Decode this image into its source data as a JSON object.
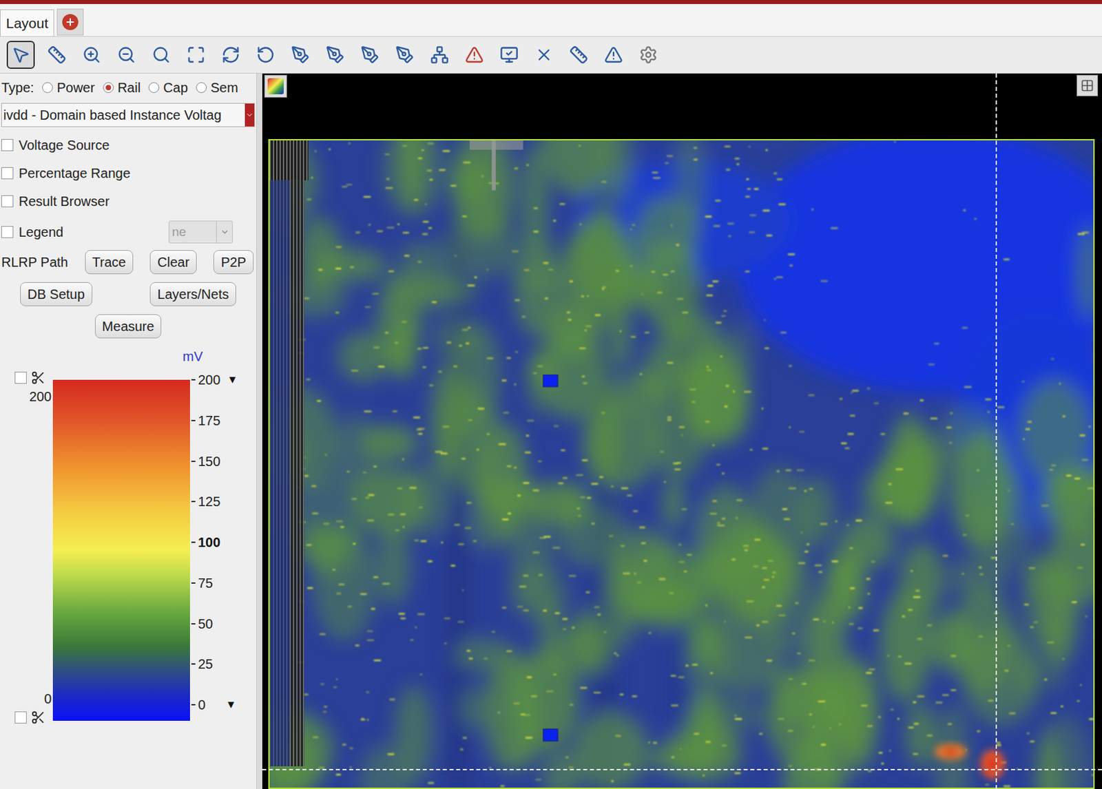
{
  "tab": {
    "label": "Layout"
  },
  "type": {
    "label": "Type:",
    "options": [
      {
        "label": "Power",
        "selected": false
      },
      {
        "label": "Rail",
        "selected": true
      },
      {
        "label": "Cap",
        "selected": false
      },
      {
        "label": "Sem",
        "selected": false
      }
    ]
  },
  "display_select": {
    "value": "ivdd - Domain based Instance Voltag"
  },
  "options": [
    {
      "label": "Voltage Source",
      "checked": false
    },
    {
      "label": "Percentage Range",
      "checked": false
    },
    {
      "label": "Result Browser",
      "checked": false
    }
  ],
  "legend": {
    "label": "Legend",
    "checked": false,
    "combo": "ne"
  },
  "path": {
    "label": "RLRP Path",
    "buttons": [
      "Trace",
      "Clear",
      "P2P"
    ]
  },
  "setup_buttons": [
    "DB Setup",
    "Layers/Nets"
  ],
  "measure": "Measure",
  "colorbar": {
    "unit": "mV",
    "max_label": "200",
    "min_label": "0",
    "max_clip_checked": false,
    "min_clip_checked": false,
    "max_arrow": "▼",
    "min_arrow": "▼",
    "ticks": [
      {
        "label": "200",
        "emphasized": false
      },
      {
        "label": "175",
        "emphasized": false
      },
      {
        "label": "150",
        "emphasized": false
      },
      {
        "label": "125",
        "emphasized": false
      },
      {
        "label": "100",
        "emphasized": true
      },
      {
        "label": "75",
        "emphasized": false
      },
      {
        "label": "50",
        "emphasized": false
      },
      {
        "label": "25",
        "emphasized": false
      },
      {
        "label": "0",
        "emphasized": false
      }
    ]
  }
}
